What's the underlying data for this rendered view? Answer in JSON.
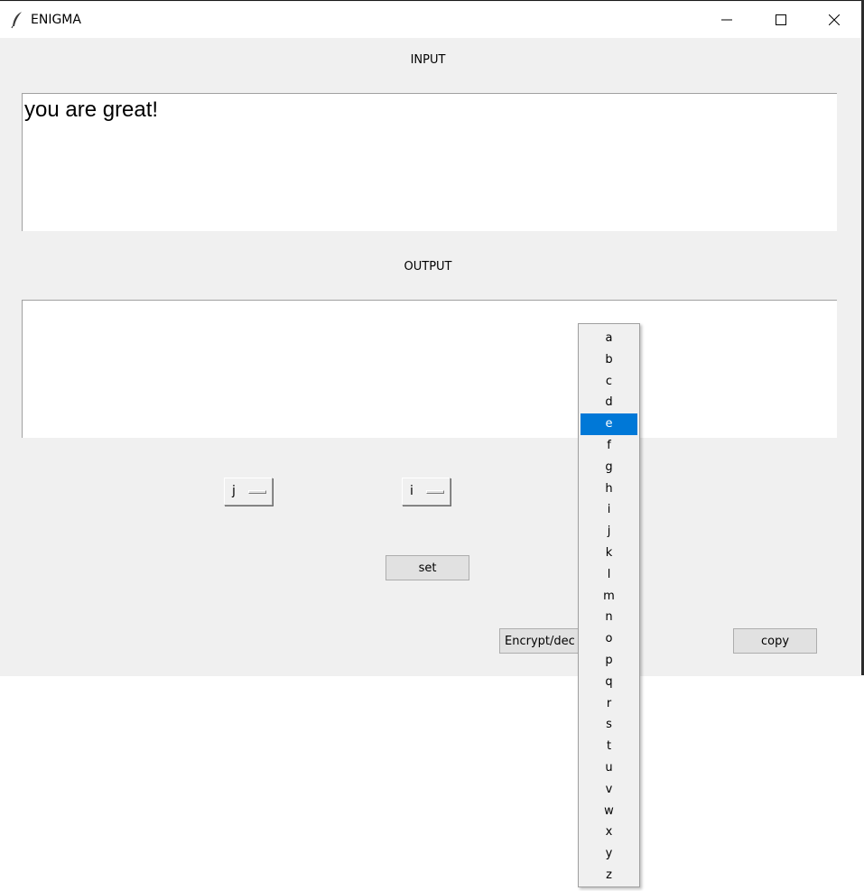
{
  "window": {
    "title": "ENIGMA"
  },
  "input": {
    "label": "INPUT",
    "value": "you are great!"
  },
  "output": {
    "label": "OUTPUT",
    "value": ""
  },
  "rotors": {
    "first_value": "j",
    "second_value": "i"
  },
  "buttons": {
    "set_label": "set",
    "encrypt_label": "Encrypt/dec",
    "copy_label": "copy"
  },
  "dropdown": {
    "options": [
      "a",
      "b",
      "c",
      "d",
      "e",
      "f",
      "g",
      "h",
      "i",
      "j",
      "k",
      "l",
      "m",
      "n",
      "o",
      "p",
      "q",
      "r",
      "s",
      "t",
      "u",
      "v",
      "w",
      "x",
      "y",
      "z"
    ],
    "highlighted": "e"
  },
  "colors": {
    "highlight": "#0078d7",
    "window_bg": "#f0f0f0"
  },
  "icons": {
    "app": "feather-icon",
    "minimize": "minimize-icon",
    "maximize": "maximize-icon",
    "close": "close-icon"
  }
}
